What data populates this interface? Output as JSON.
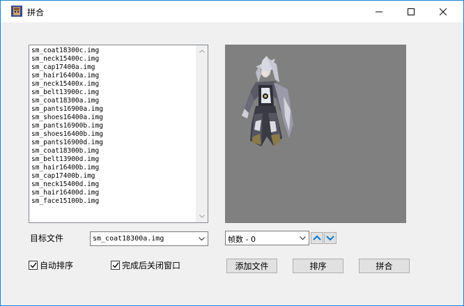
{
  "window": {
    "title": "拼合",
    "minimize_icon": "minimize-icon",
    "maximize_icon": "maximize-icon",
    "close_icon": "close-icon"
  },
  "file_list": {
    "items": [
      "sm_coat18300c.img",
      "sm_neck15400c.img",
      "sm_cap17400a.img",
      "sm_hair16400a.img",
      "sm_neck15400x.img",
      "sm_belt13900c.img",
      "sm_coat18300a.img",
      "sm_pants16900a.img",
      "sm_shoes16400a.img",
      "sm_pants16900b.img",
      "sm_shoes16400b.img",
      "sm_pants16900d.img",
      "sm_coat18300b.img",
      "sm_belt13900d.img",
      "sm_hair16400b.img",
      "sm_cap17400b.img",
      "sm_neck15400d.img",
      "sm_hair16400d.img",
      "sm_face15100b.img"
    ]
  },
  "preview": {
    "background": "#808080"
  },
  "target": {
    "label": "目标文件",
    "value": "sm_coat18300a.img"
  },
  "frame": {
    "value": "帧数 - 0"
  },
  "options": {
    "auto_sort": {
      "label": "自动排序",
      "checked": true
    },
    "close_after": {
      "label": "完成后关闭窗口",
      "checked": true
    }
  },
  "buttons": {
    "add_file": "添加文件",
    "sort": "排序",
    "merge": "拼合"
  },
  "colors": {
    "accent": "#1883d7",
    "spin_arrow": "#0078d7"
  }
}
